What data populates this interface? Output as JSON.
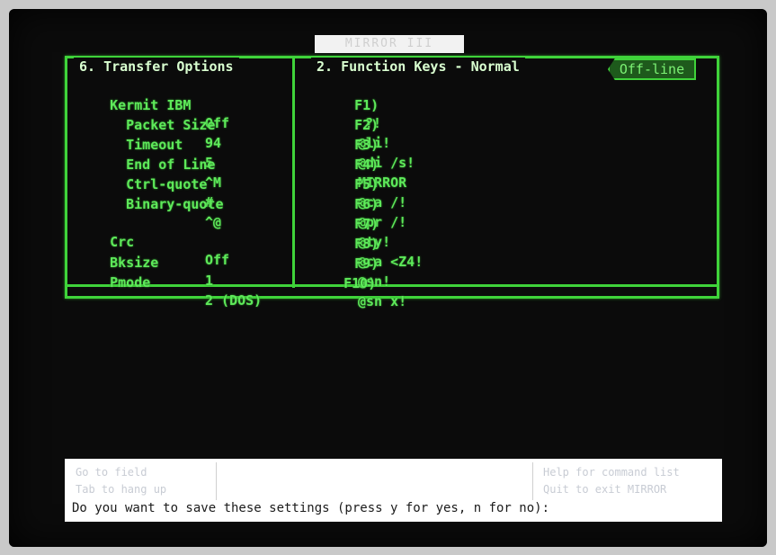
{
  "app": {
    "title_highlight": "MIRROR III"
  },
  "transfer": {
    "title": "6. Transfer Options",
    "rows": [
      {
        "label": "Kermit IBM",
        "value": "Off"
      },
      {
        "label": "Packet Size",
        "value": "94"
      },
      {
        "label": "Timeout",
        "value": "5"
      },
      {
        "label": "End of Line",
        "value": "^M"
      },
      {
        "label": "Ctrl-quote",
        "value": "#"
      },
      {
        "label": "Binary-quote",
        "value": "^@"
      },
      {
        "label": "Crc",
        "value": "Off"
      },
      {
        "label": "Bksize",
        "value": "1"
      },
      {
        "label": "Pmode",
        "value": "2 (DOS)"
      }
    ]
  },
  "function_keys": {
    "title": "2. Function Keys - Normal",
    "status": "Off-line",
    "keys": [
      {
        "key": "F1)",
        "value": "?!"
      },
      {
        "key": "F2)",
        "value": "@li!"
      },
      {
        "key": "F3)",
        "value": "@di /s!"
      },
      {
        "key": "F4)",
        "value": "MIRROR"
      },
      {
        "key": "F5)",
        "value": "@ca /!"
      },
      {
        "key": "F6)",
        "value": "@pr /!"
      },
      {
        "key": "F7)",
        "value": "@ty!"
      },
      {
        "key": "F8)",
        "value": "@ca <Z4!"
      },
      {
        "key": "F9)",
        "value": "@sn!"
      },
      {
        "key": "F10)",
        "value": "@sn x!"
      }
    ]
  },
  "status_bar": {
    "cells": [
      "Go to field",
      "Tab to hang up",
      "Help for command list",
      "Quit to exit MIRROR"
    ],
    "prompt": "Do you want to save these settings (press y for yes, n for no):"
  },
  "colors": {
    "phosphor": "#5ee95a",
    "frame": "#3fd33a",
    "background": "#0b0b0b"
  }
}
